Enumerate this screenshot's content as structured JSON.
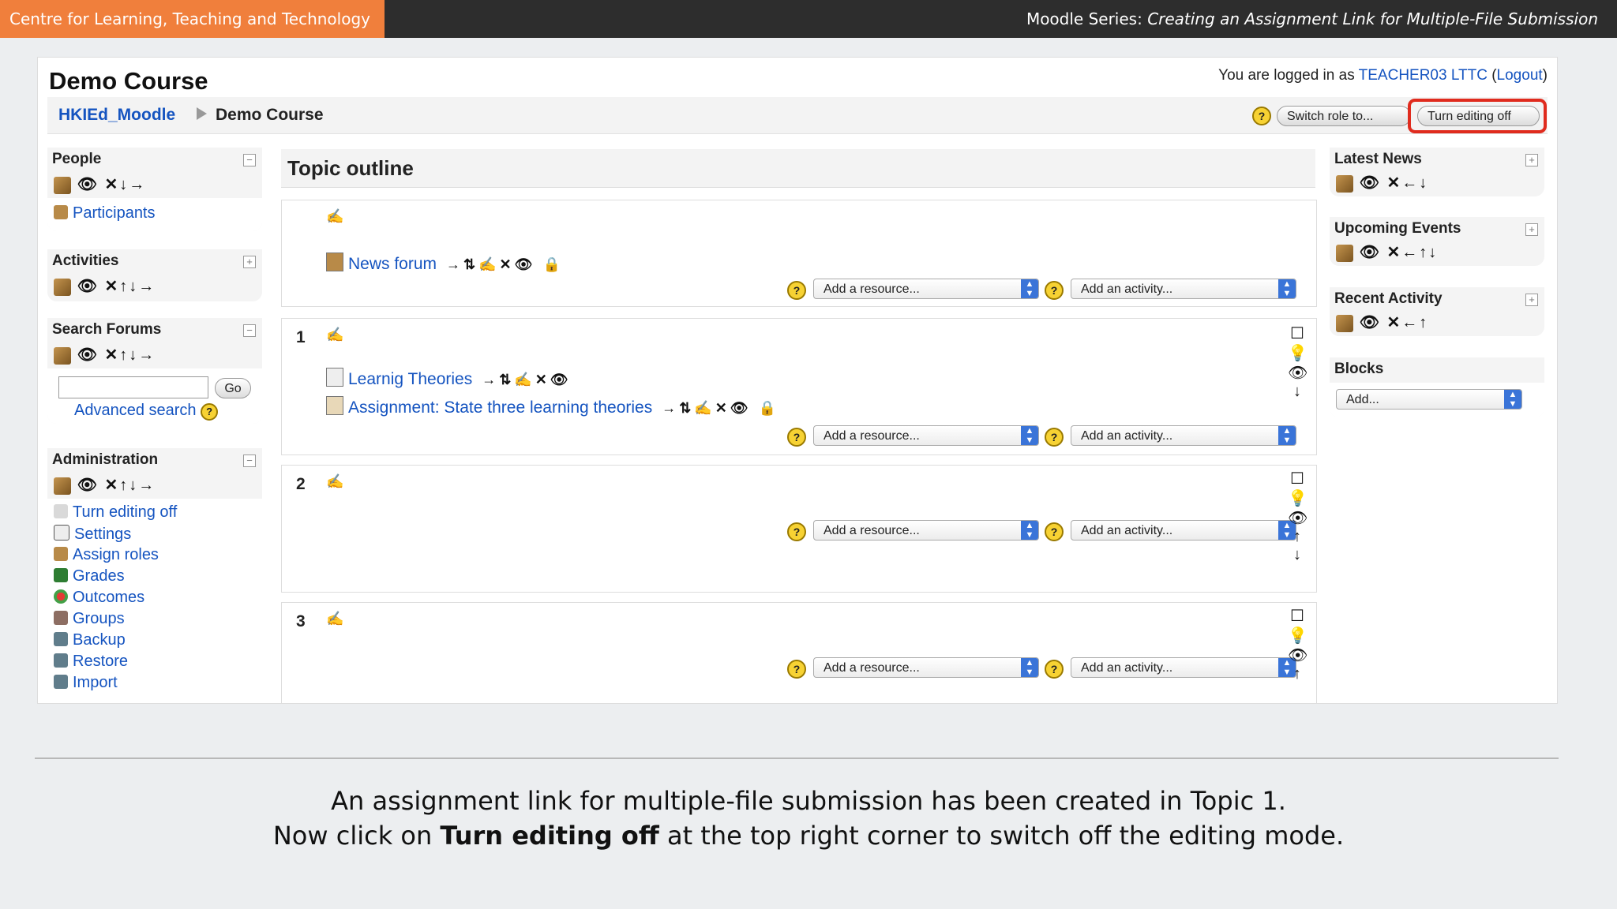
{
  "header": {
    "brand": "Centre for Learning, Teaching and Technology",
    "series_prefix": "Moodle Series:",
    "series_title": "Creating an Assignment Link for Multiple-File Submission"
  },
  "course": {
    "title": "Demo Course",
    "login_prefix": "You are logged in as",
    "user": "TEACHER03 LTTC",
    "logout": "Logout"
  },
  "breadcrumb": {
    "home": "HKIEd_Moodle",
    "current": "Demo Course"
  },
  "toolbar": {
    "switch_role": "Switch role to...",
    "turn_editing_off": "Turn editing off"
  },
  "left_blocks": {
    "people": {
      "title": "People",
      "toggle": "−",
      "icons": "👁 ✕↓→",
      "item": "Participants"
    },
    "activities": {
      "title": "Activities",
      "toggle": "+",
      "icons": "👁 ✕↑↓→"
    },
    "search": {
      "title": "Search Forums",
      "toggle": "−",
      "icons": "👁 ✕↑↓→",
      "go": "Go",
      "advanced": "Advanced search"
    },
    "admin": {
      "title": "Administration",
      "toggle": "−",
      "icons": "👁 ✕↑↓→",
      "items": [
        "Turn editing off",
        "Settings",
        "Assign roles",
        "Grades",
        "Outcomes",
        "Groups",
        "Backup",
        "Restore",
        "Import"
      ]
    }
  },
  "main": {
    "title": "Topic outline",
    "add_resource": "Add a resource...",
    "add_activity": "Add an activity...",
    "news_forum": "News forum",
    "section1": {
      "number": "1",
      "items": [
        "Learnig Theories",
        "Assignment: State three learning theories"
      ]
    },
    "section2": {
      "number": "2"
    },
    "section3": {
      "number": "3"
    }
  },
  "right_blocks": {
    "latest_news": {
      "title": "Latest News",
      "toggle": "+",
      "icons": "👁 ✕←↓"
    },
    "upcoming": {
      "title": "Upcoming Events",
      "toggle": "+",
      "icons": "👁 ✕←↑↓"
    },
    "recent": {
      "title": "Recent Activity",
      "toggle": "+",
      "icons": "👁 ✕←↑"
    },
    "blocks": {
      "title": "Blocks",
      "add": "Add..."
    }
  },
  "caption": {
    "line1": "An assignment link for multiple-file submission has been created in Topic 1.",
    "line2_prefix": "Now click on",
    "line2_bold": "Turn editing off",
    "line2_suffix": "at the top right corner to switch off the editing mode."
  }
}
